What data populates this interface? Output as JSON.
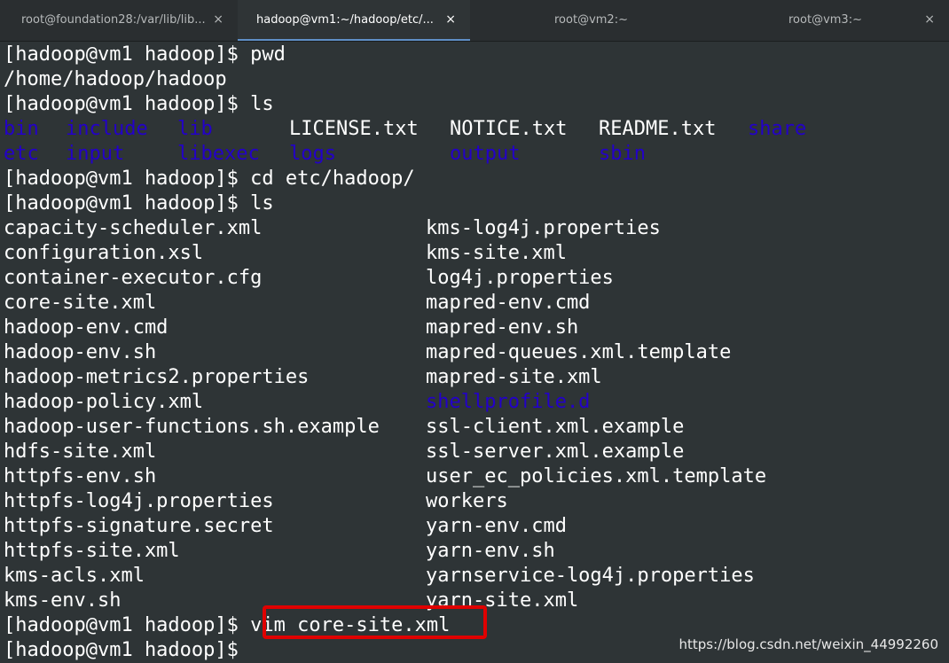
{
  "tabs": [
    {
      "title": "root@foundation28:/var/lib/lib...",
      "close": "×"
    },
    {
      "title": "hadoop@vm1:~/hadoop/etc/...",
      "close": "×"
    },
    {
      "title": "root@vm2:~",
      "close": "×"
    },
    {
      "title": "root@vm3:~",
      "close": "×"
    }
  ],
  "terminal": {
    "prompt": "[hadoop@vm1 hadoop]$ ",
    "cmd1": "pwd",
    "pwd_output": "/home/hadoop/hadoop",
    "cmd2": "ls",
    "ls1_row1": [
      "bin",
      "include",
      "lib",
      "LICENSE.txt",
      "NOTICE.txt",
      "README.txt",
      "share"
    ],
    "ls1_row2": [
      "etc",
      "input",
      "libexec",
      "logs",
      "output",
      "sbin"
    ],
    "cmd3": "cd etc/hadoop/",
    "cmd4": "ls",
    "files_left": [
      "capacity-scheduler.xml",
      "configuration.xsl",
      "container-executor.cfg",
      "core-site.xml",
      "hadoop-env.cmd",
      "hadoop-env.sh",
      "hadoop-metrics2.properties",
      "hadoop-policy.xml",
      "hadoop-user-functions.sh.example",
      "hdfs-site.xml",
      "httpfs-env.sh",
      "httpfs-log4j.properties",
      "httpfs-signature.secret",
      "httpfs-site.xml",
      "kms-acls.xml",
      "kms-env.sh"
    ],
    "files_right": [
      "kms-log4j.properties",
      "kms-site.xml",
      "log4j.properties",
      "mapred-env.cmd",
      "mapred-env.sh",
      "mapred-queues.xml.template",
      "mapred-site.xml",
      "shellprofile.d",
      "ssl-client.xml.example",
      "ssl-server.xml.example",
      "user_ec_policies.xml.template",
      "workers",
      "yarn-env.cmd",
      "yarn-env.sh",
      "yarnservice-log4j.properties",
      "yarn-site.xml"
    ],
    "cmd5": "vim core-site.xml"
  },
  "colors": {
    "directory": "#2300c8",
    "text": "#ffffff",
    "background": "#2e3436",
    "highlight": "#e00000"
  },
  "watermark": "https://blog.csdn.net/weixin_44992260"
}
